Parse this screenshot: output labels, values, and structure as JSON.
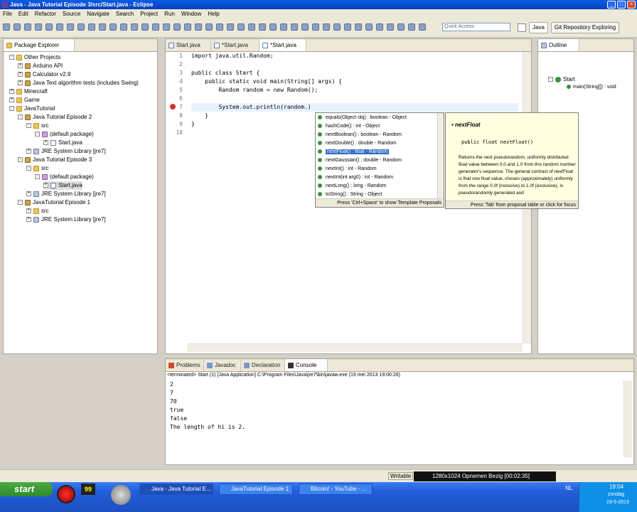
{
  "window": {
    "title": "Java - Java Tutorial Episode 3/src/Start.java - Eclipse"
  },
  "menu": [
    "File",
    "Edit",
    "Refactor",
    "Source",
    "Navigate",
    "Search",
    "Project",
    "Run",
    "Window",
    "Help"
  ],
  "toolbar": {
    "quick_access_placeholder": "Quick Access"
  },
  "perspectives": {
    "java": "Java",
    "git": "Git Repository Exploring"
  },
  "package_explorer": {
    "tab": "Package Explorer",
    "rows": [
      {
        "label": "Other Projects"
      },
      {
        "label": "Arduino API"
      },
      {
        "label": "Calculator v2.9"
      },
      {
        "label": "Java Text algorithm tests (includes Swing)"
      },
      {
        "label": "Minecraft"
      },
      {
        "label": "Game"
      },
      {
        "label": "JavaTutorial"
      },
      {
        "label": "Java Tutorial Episode 2"
      },
      {
        "label": "src"
      },
      {
        "label": "(default package)"
      },
      {
        "label": "Start.java"
      },
      {
        "label": "JRE System Library [jre7]"
      },
      {
        "label": "Java Tutorial Episode 3"
      },
      {
        "label": "src"
      },
      {
        "label": "(default package)"
      },
      {
        "label": "Start.java"
      },
      {
        "label": "JRE System Library [jre7]"
      },
      {
        "label": "JavaTutorial Episode 1"
      },
      {
        "label": "src"
      },
      {
        "label": "JRE System Library [jre7]"
      }
    ]
  },
  "editor": {
    "tabs": [
      "Start.java",
      "*Start.java",
      "*Start.java"
    ],
    "line_numbers": [
      "1",
      "2",
      "3",
      "4",
      "5",
      "6",
      "7",
      "8",
      "9",
      "10"
    ],
    "lines": [
      "import java.util.Random;",
      "",
      "public class Start {",
      "    public static void main(String[] args) {",
      "        Random random = new Random();",
      "",
      "        System.out.println(random.)",
      "    }",
      "}",
      ""
    ]
  },
  "proposals": {
    "items": [
      "equals(Object obj) : boolean - Object",
      "hashCode() : int - Object",
      "nextBoolean() : boolean - Random",
      "nextDouble() : double - Random",
      "nextFloat() : float - Random",
      "nextGaussian() : double - Random",
      "nextInt() : int - Random",
      "nextInt(int arg0) : int - Random",
      "nextLong() : long - Random",
      "toString() : String - Object"
    ],
    "selected_index": 4,
    "footer": "Press 'Ctrl+Space' to show Template Proposals"
  },
  "javadoc": {
    "title": "nextFloat",
    "signature": "public float nextFloat()",
    "description": "Returns the next pseudorandom, uniformly distributed float value between 0.0 and 1.0 from this random number generator's sequence. The general contract of nextFloat is that one float value, chosen (approximately) uniformly from the range 0.0f (inclusive) to 1.0f (exclusive), is pseudorandomly generated and",
    "footer": "Press 'Tab' from proposal table or click for focus"
  },
  "outline": {
    "tab": "Outline",
    "class": "Start",
    "method": "main(String[]) : void"
  },
  "bottom_tabs": [
    "Problems",
    "Javadoc",
    "Declaration",
    "Console"
  ],
  "console": {
    "header": "<terminated> Start (1) [Java Application] C:\\Program Files\\Java\\jre7\\bin\\javaw.exe (19 mei 2013 19:00:26)",
    "lines": [
      "2",
      "7",
      "70",
      "true",
      "false",
      "The length of hi is 2."
    ]
  },
  "status": {
    "writable": "Writable",
    "recorder": "1280x1024  Opnemen Bezig [00:02:35]"
  },
  "taskbar": {
    "start": "start",
    "tasks": [
      "Java - Java Tutorial E...",
      "JavaTutorial Episode 1",
      "Bitcoin! - YouTube - ..."
    ],
    "lang": "NL",
    "time": "19:04",
    "day": "zondag",
    "date": "19-5-2013"
  }
}
